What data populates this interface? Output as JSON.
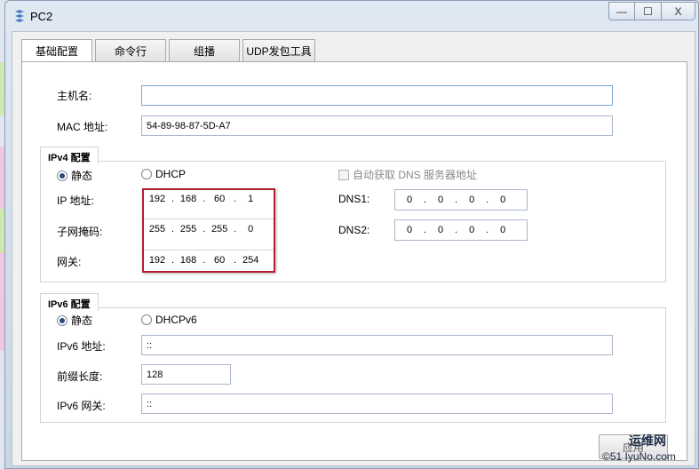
{
  "window": {
    "title": "PC2"
  },
  "controls": {
    "min": "—",
    "max": "☐",
    "close": "X"
  },
  "tabs": [
    "基础配置",
    "命令行",
    "组播",
    "UDP发包工具"
  ],
  "basic": {
    "hostname_label": "主机名:",
    "hostname_value": "",
    "mac_label": "MAC 地址:",
    "mac_value": "54-89-98-87-5D-A7"
  },
  "ipv4": {
    "group_title": "IPv4 配置",
    "static_label": "静态",
    "dhcp_label": "DHCP",
    "auto_dns_label": "自动获取 DNS 服务器地址",
    "ip_label": "IP 地址:",
    "ip": [
      "192",
      "168",
      "60",
      "1"
    ],
    "mask_label": "子网掩码:",
    "mask": [
      "255",
      "255",
      "255",
      "0"
    ],
    "gw_label": "网关:",
    "gw": [
      "192",
      "168",
      "60",
      "254"
    ],
    "dns1_label": "DNS1:",
    "dns1": [
      "0",
      "0",
      "0",
      "0"
    ],
    "dns2_label": "DNS2:",
    "dns2": [
      "0",
      "0",
      "0",
      "0"
    ]
  },
  "ipv6": {
    "group_title": "IPv6 配置",
    "static_label": "静态",
    "dhcp_label": "DHCPv6",
    "addr_label": "IPv6 地址:",
    "addr_value": "::",
    "prefix_label": "前缀长度:",
    "prefix_value": "128",
    "gw_label": "IPv6 网关:",
    "gw_value": "::"
  },
  "apply_label": "应用",
  "watermark": {
    "top": "运维网",
    "bottom": "©51 IyuNo.com"
  }
}
